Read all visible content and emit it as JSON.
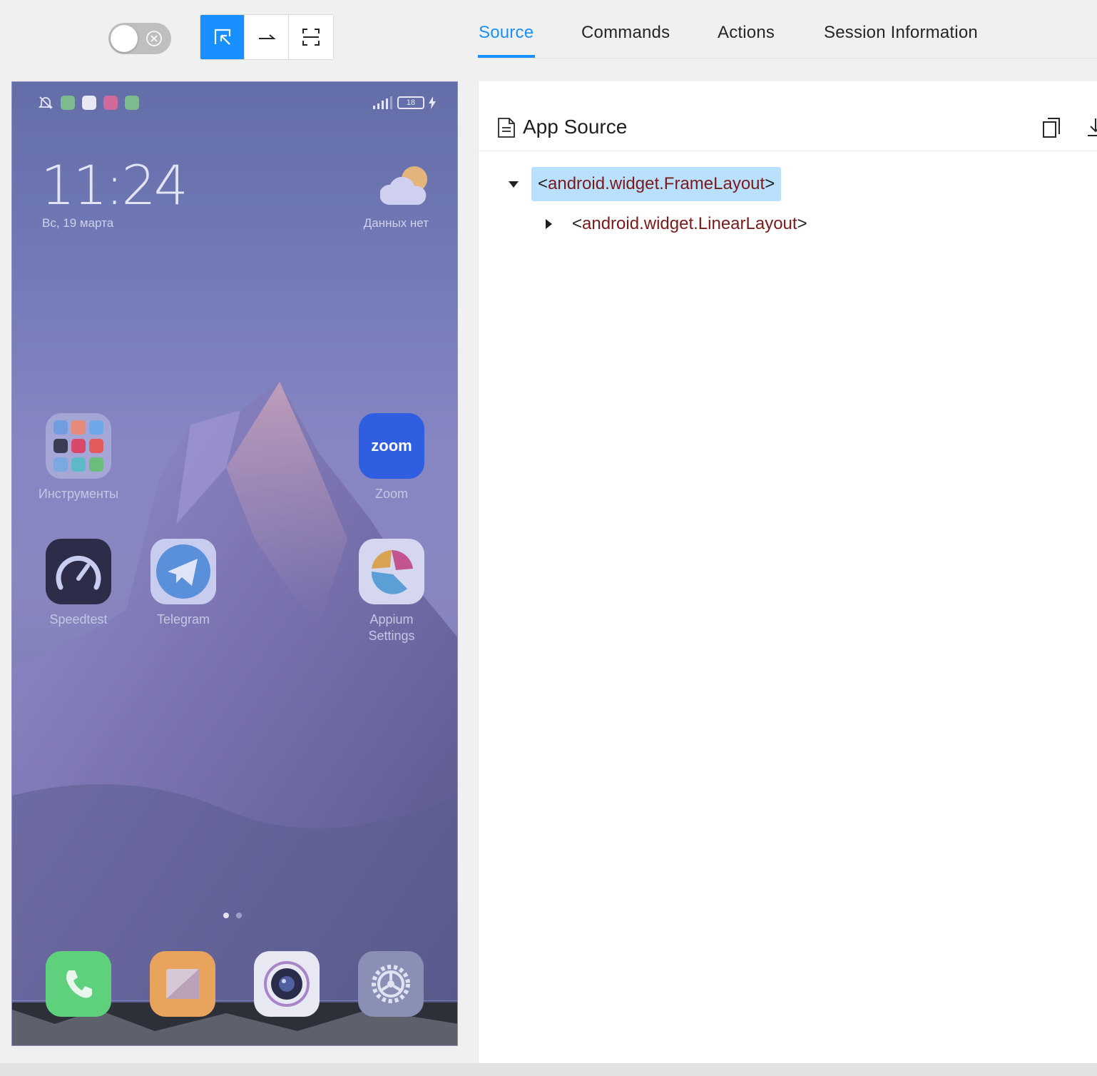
{
  "toolbar": {
    "toggle_state": "off",
    "buttons": [
      {
        "icon": "select-elements-icon",
        "active": true
      },
      {
        "icon": "swipe-icon",
        "active": false
      },
      {
        "icon": "tap-by-coordinates-icon",
        "active": false
      }
    ]
  },
  "tabs": [
    {
      "label": "Source",
      "active": true
    },
    {
      "label": "Commands",
      "active": false
    },
    {
      "label": "Actions",
      "active": false
    },
    {
      "label": "Session Information",
      "active": false
    }
  ],
  "device": {
    "clock": "11:24",
    "date": "Вс, 19 марта",
    "weather_text": "Данных нет",
    "battery": "18",
    "home_apps": [
      {
        "label": "Инструменты",
        "icon": "tools-folder-icon"
      },
      {
        "label": "Zoom",
        "icon": "zoom-icon",
        "icon_text": "zoom"
      },
      {
        "label": "Speedtest",
        "icon": "speedtest-icon"
      },
      {
        "label": "Telegram",
        "icon": "telegram-icon"
      },
      {
        "label": "Appium Settings",
        "icon": "appium-icon"
      }
    ],
    "dock_apps": [
      {
        "icon": "phone-icon"
      },
      {
        "icon": "notes-icon"
      },
      {
        "icon": "camera-icon"
      },
      {
        "icon": "settings-icon"
      }
    ],
    "page_dots": {
      "count": 2,
      "active": 0
    }
  },
  "source": {
    "title": "App Source",
    "tree": [
      {
        "open": "<",
        "name": "android.widget.FrameLayout",
        "close": ">",
        "expanded": true,
        "selected": true,
        "depth": 0
      },
      {
        "open": "<",
        "name": "android.widget.LinearLayout",
        "close": ">",
        "expanded": false,
        "selected": false,
        "depth": 1
      }
    ]
  },
  "colors": {
    "accent": "#1890ff",
    "tag_name": "#7b1a1a",
    "selected_bg": "#bae0ff"
  }
}
